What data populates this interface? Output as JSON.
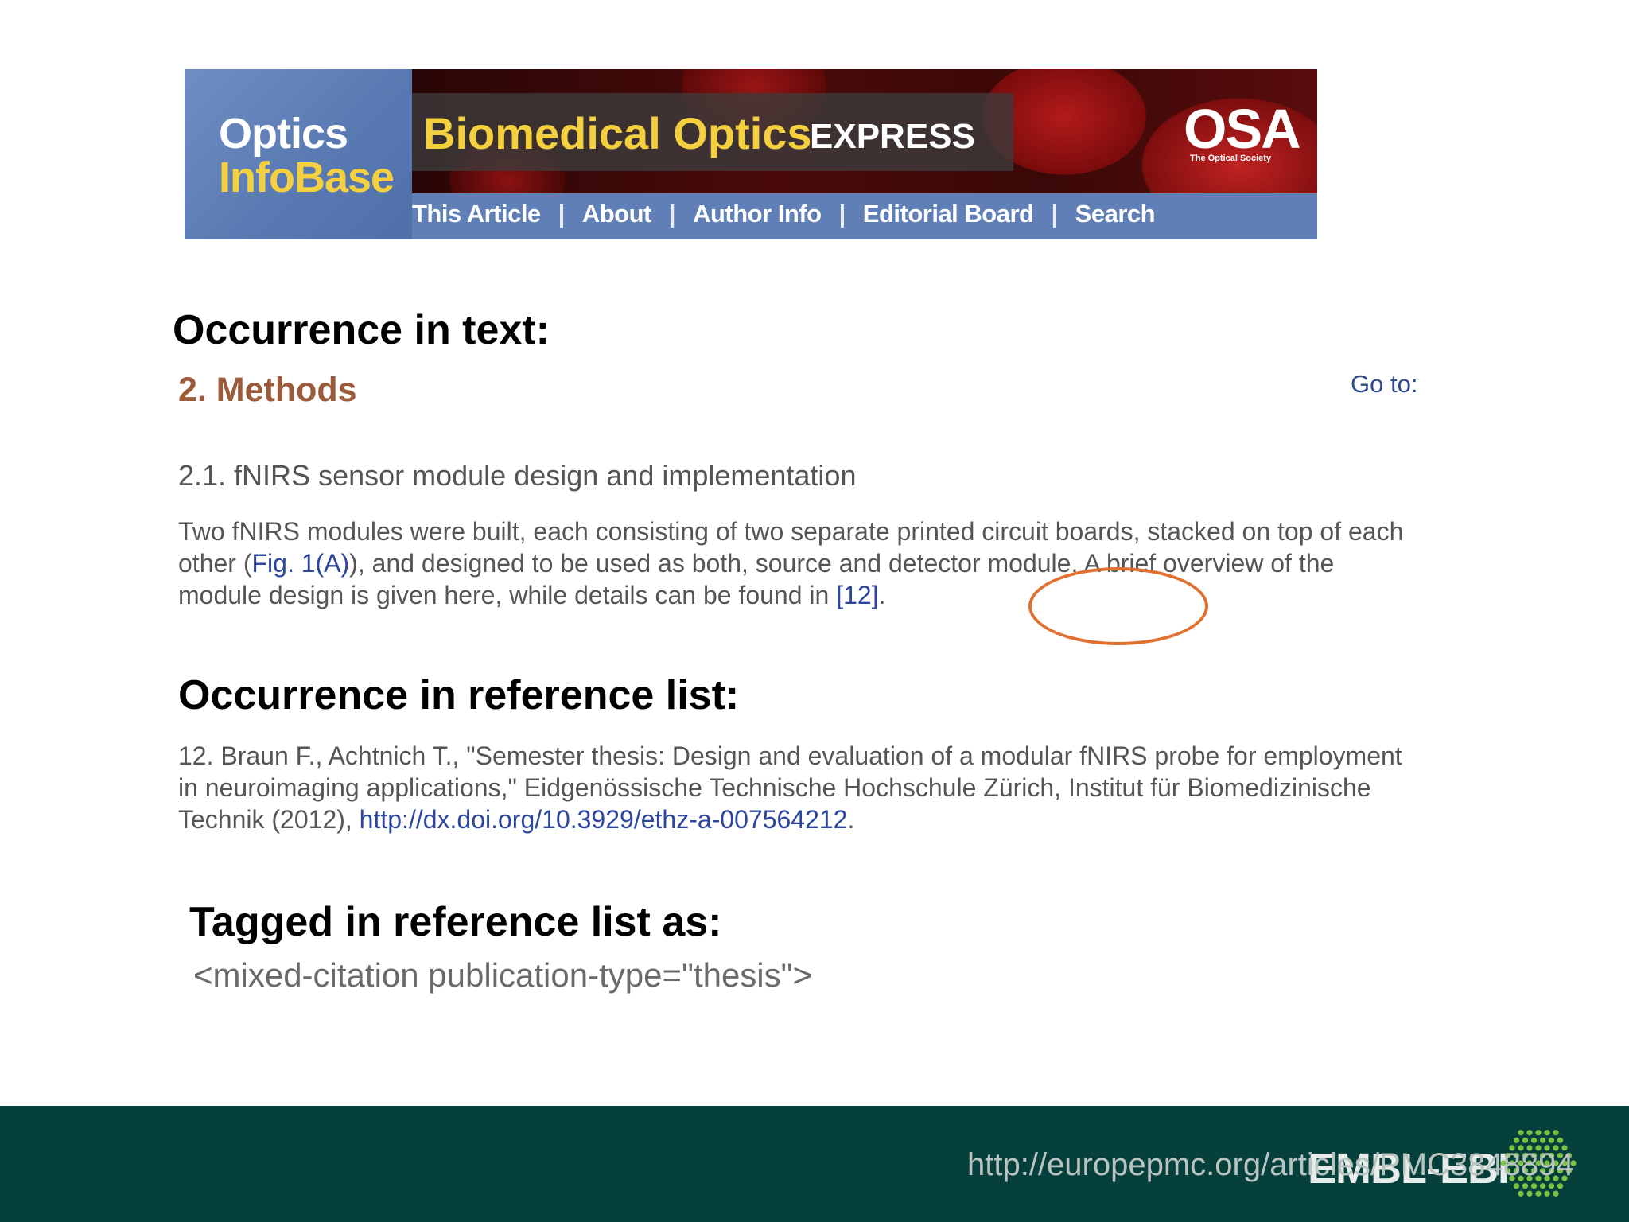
{
  "banner": {
    "brand_line1": "Optics",
    "brand_line2": "InfoBase",
    "journal_title": "Biomedical Optics",
    "journal_suffix": "EXPRESS",
    "publisher_logo": "OSA",
    "publisher_tagline": "The Optical Society",
    "nav": [
      {
        "label": "This Article"
      },
      {
        "label": "About"
      },
      {
        "label": "Author Info"
      },
      {
        "label": "Editorial Board"
      },
      {
        "label": "Search"
      }
    ],
    "separator": "|"
  },
  "section_text": {
    "heading": "Occurrence in text:",
    "methods_title": "2. Methods",
    "goto_label": "Go to:",
    "subsection_title": "2.1. fNIRS sensor module design and implementation",
    "paragraph_before_fig": "Two fNIRS modules were built, each consisting of two separate printed circuit boards, stacked on top of each other (",
    "fig_link": "Fig. 1(A)",
    "paragraph_after_fig": "), and designed to be used as both, source and detector module. A brief overview of the module design is given here, while details can be found in ",
    "citation_link": "[12]",
    "paragraph_end": "."
  },
  "section_reference": {
    "heading": "Occurrence in reference list:",
    "reference_text": "12. Braun F., Achtnich T., \"Semester thesis: Design and evaluation of a modular fNIRS probe for employment in neuroimaging applications,\" Eidgenössische Technische Hochschule Zürich, Institut für Biomedizinische Technik (2012), ",
    "reference_link": "http://dx.doi.org/10.3929/ethz-a-007564212",
    "reference_end": "."
  },
  "section_tag": {
    "heading": "Tagged in reference list as:",
    "code": "<mixed-citation publication-type=\"thesis\">"
  },
  "footer": {
    "logo_text": "EMBL-EBI",
    "url": "http://europepmc.org/articles/PMC3848894"
  },
  "colors": {
    "banner_blue": "#5f7fb6",
    "brand_yellow": "#f4d03f",
    "methods_brown": "#9b5a3a",
    "link_blue": "#2b45a0",
    "highlight_orange": "#e07030",
    "footer_green": "#05403d",
    "logo_hex_green": "#7cc242"
  }
}
